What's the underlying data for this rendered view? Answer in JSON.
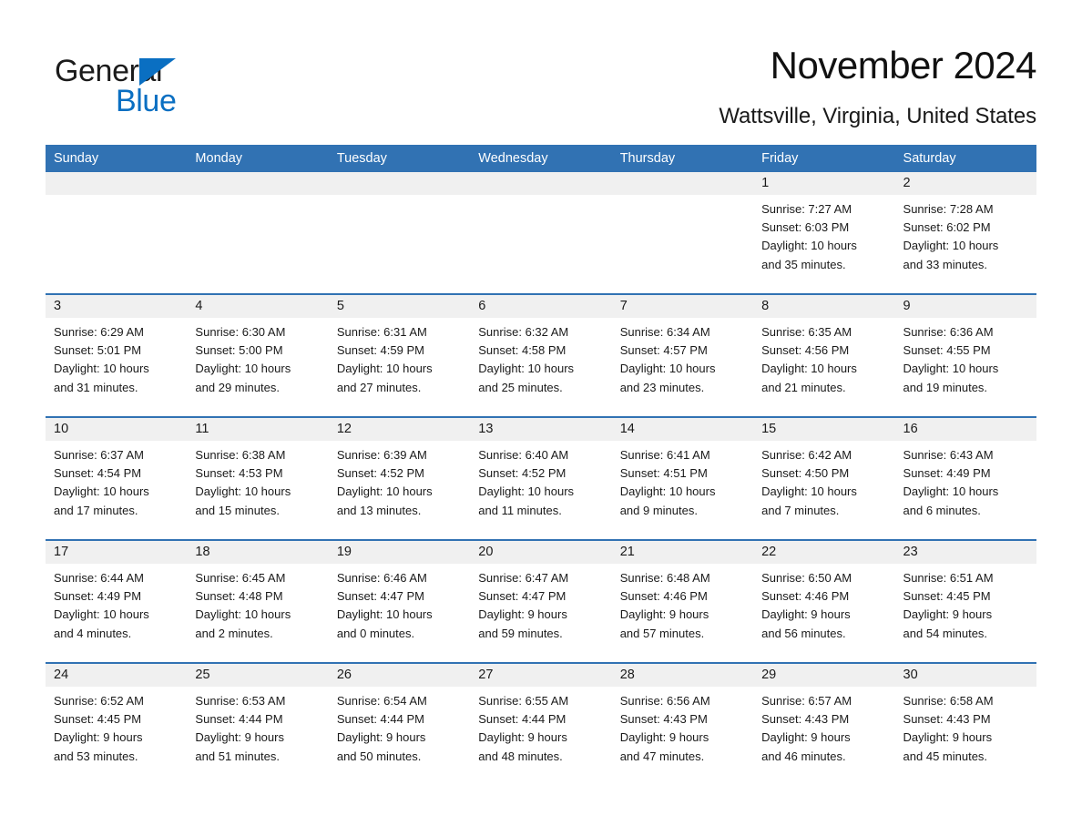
{
  "brand": {
    "name_part1": "General",
    "name_part2": "Blue",
    "triangle_color": "#0a6fc2"
  },
  "header": {
    "title": "November 2024",
    "subtitle": "Wattsville, Virginia, United States"
  },
  "colors": {
    "header_blue": "#3172b3",
    "day_band_gray": "#f0f0f0",
    "brand_blue": "#0a6fc2",
    "text": "#1a1a1a"
  },
  "weekdays": [
    "Sunday",
    "Monday",
    "Tuesday",
    "Wednesday",
    "Thursday",
    "Friday",
    "Saturday"
  ],
  "weeks": [
    [
      {
        "day": "",
        "empty": true
      },
      {
        "day": "",
        "empty": true
      },
      {
        "day": "",
        "empty": true
      },
      {
        "day": "",
        "empty": true
      },
      {
        "day": "",
        "empty": true
      },
      {
        "day": "1",
        "sunrise": "Sunrise: 7:27 AM",
        "sunset": "Sunset: 6:03 PM",
        "daylight_line1": "Daylight: 10 hours",
        "daylight_line2": "and 35 minutes."
      },
      {
        "day": "2",
        "sunrise": "Sunrise: 7:28 AM",
        "sunset": "Sunset: 6:02 PM",
        "daylight_line1": "Daylight: 10 hours",
        "daylight_line2": "and 33 minutes."
      }
    ],
    [
      {
        "day": "3",
        "sunrise": "Sunrise: 6:29 AM",
        "sunset": "Sunset: 5:01 PM",
        "daylight_line1": "Daylight: 10 hours",
        "daylight_line2": "and 31 minutes."
      },
      {
        "day": "4",
        "sunrise": "Sunrise: 6:30 AM",
        "sunset": "Sunset: 5:00 PM",
        "daylight_line1": "Daylight: 10 hours",
        "daylight_line2": "and 29 minutes."
      },
      {
        "day": "5",
        "sunrise": "Sunrise: 6:31 AM",
        "sunset": "Sunset: 4:59 PM",
        "daylight_line1": "Daylight: 10 hours",
        "daylight_line2": "and 27 minutes."
      },
      {
        "day": "6",
        "sunrise": "Sunrise: 6:32 AM",
        "sunset": "Sunset: 4:58 PM",
        "daylight_line1": "Daylight: 10 hours",
        "daylight_line2": "and 25 minutes."
      },
      {
        "day": "7",
        "sunrise": "Sunrise: 6:34 AM",
        "sunset": "Sunset: 4:57 PM",
        "daylight_line1": "Daylight: 10 hours",
        "daylight_line2": "and 23 minutes."
      },
      {
        "day": "8",
        "sunrise": "Sunrise: 6:35 AM",
        "sunset": "Sunset: 4:56 PM",
        "daylight_line1": "Daylight: 10 hours",
        "daylight_line2": "and 21 minutes."
      },
      {
        "day": "9",
        "sunrise": "Sunrise: 6:36 AM",
        "sunset": "Sunset: 4:55 PM",
        "daylight_line1": "Daylight: 10 hours",
        "daylight_line2": "and 19 minutes."
      }
    ],
    [
      {
        "day": "10",
        "sunrise": "Sunrise: 6:37 AM",
        "sunset": "Sunset: 4:54 PM",
        "daylight_line1": "Daylight: 10 hours",
        "daylight_line2": "and 17 minutes."
      },
      {
        "day": "11",
        "sunrise": "Sunrise: 6:38 AM",
        "sunset": "Sunset: 4:53 PM",
        "daylight_line1": "Daylight: 10 hours",
        "daylight_line2": "and 15 minutes."
      },
      {
        "day": "12",
        "sunrise": "Sunrise: 6:39 AM",
        "sunset": "Sunset: 4:52 PM",
        "daylight_line1": "Daylight: 10 hours",
        "daylight_line2": "and 13 minutes."
      },
      {
        "day": "13",
        "sunrise": "Sunrise: 6:40 AM",
        "sunset": "Sunset: 4:52 PM",
        "daylight_line1": "Daylight: 10 hours",
        "daylight_line2": "and 11 minutes."
      },
      {
        "day": "14",
        "sunrise": "Sunrise: 6:41 AM",
        "sunset": "Sunset: 4:51 PM",
        "daylight_line1": "Daylight: 10 hours",
        "daylight_line2": "and 9 minutes."
      },
      {
        "day": "15",
        "sunrise": "Sunrise: 6:42 AM",
        "sunset": "Sunset: 4:50 PM",
        "daylight_line1": "Daylight: 10 hours",
        "daylight_line2": "and 7 minutes."
      },
      {
        "day": "16",
        "sunrise": "Sunrise: 6:43 AM",
        "sunset": "Sunset: 4:49 PM",
        "daylight_line1": "Daylight: 10 hours",
        "daylight_line2": "and 6 minutes."
      }
    ],
    [
      {
        "day": "17",
        "sunrise": "Sunrise: 6:44 AM",
        "sunset": "Sunset: 4:49 PM",
        "daylight_line1": "Daylight: 10 hours",
        "daylight_line2": "and 4 minutes."
      },
      {
        "day": "18",
        "sunrise": "Sunrise: 6:45 AM",
        "sunset": "Sunset: 4:48 PM",
        "daylight_line1": "Daylight: 10 hours",
        "daylight_line2": "and 2 minutes."
      },
      {
        "day": "19",
        "sunrise": "Sunrise: 6:46 AM",
        "sunset": "Sunset: 4:47 PM",
        "daylight_line1": "Daylight: 10 hours",
        "daylight_line2": "and 0 minutes."
      },
      {
        "day": "20",
        "sunrise": "Sunrise: 6:47 AM",
        "sunset": "Sunset: 4:47 PM",
        "daylight_line1": "Daylight: 9 hours",
        "daylight_line2": "and 59 minutes."
      },
      {
        "day": "21",
        "sunrise": "Sunrise: 6:48 AM",
        "sunset": "Sunset: 4:46 PM",
        "daylight_line1": "Daylight: 9 hours",
        "daylight_line2": "and 57 minutes."
      },
      {
        "day": "22",
        "sunrise": "Sunrise: 6:50 AM",
        "sunset": "Sunset: 4:46 PM",
        "daylight_line1": "Daylight: 9 hours",
        "daylight_line2": "and 56 minutes."
      },
      {
        "day": "23",
        "sunrise": "Sunrise: 6:51 AM",
        "sunset": "Sunset: 4:45 PM",
        "daylight_line1": "Daylight: 9 hours",
        "daylight_line2": "and 54 minutes."
      }
    ],
    [
      {
        "day": "24",
        "sunrise": "Sunrise: 6:52 AM",
        "sunset": "Sunset: 4:45 PM",
        "daylight_line1": "Daylight: 9 hours",
        "daylight_line2": "and 53 minutes."
      },
      {
        "day": "25",
        "sunrise": "Sunrise: 6:53 AM",
        "sunset": "Sunset: 4:44 PM",
        "daylight_line1": "Daylight: 9 hours",
        "daylight_line2": "and 51 minutes."
      },
      {
        "day": "26",
        "sunrise": "Sunrise: 6:54 AM",
        "sunset": "Sunset: 4:44 PM",
        "daylight_line1": "Daylight: 9 hours",
        "daylight_line2": "and 50 minutes."
      },
      {
        "day": "27",
        "sunrise": "Sunrise: 6:55 AM",
        "sunset": "Sunset: 4:44 PM",
        "daylight_line1": "Daylight: 9 hours",
        "daylight_line2": "and 48 minutes."
      },
      {
        "day": "28",
        "sunrise": "Sunrise: 6:56 AM",
        "sunset": "Sunset: 4:43 PM",
        "daylight_line1": "Daylight: 9 hours",
        "daylight_line2": "and 47 minutes."
      },
      {
        "day": "29",
        "sunrise": "Sunrise: 6:57 AM",
        "sunset": "Sunset: 4:43 PM",
        "daylight_line1": "Daylight: 9 hours",
        "daylight_line2": "and 46 minutes."
      },
      {
        "day": "30",
        "sunrise": "Sunrise: 6:58 AM",
        "sunset": "Sunset: 4:43 PM",
        "daylight_line1": "Daylight: 9 hours",
        "daylight_line2": "and 45 minutes."
      }
    ]
  ]
}
